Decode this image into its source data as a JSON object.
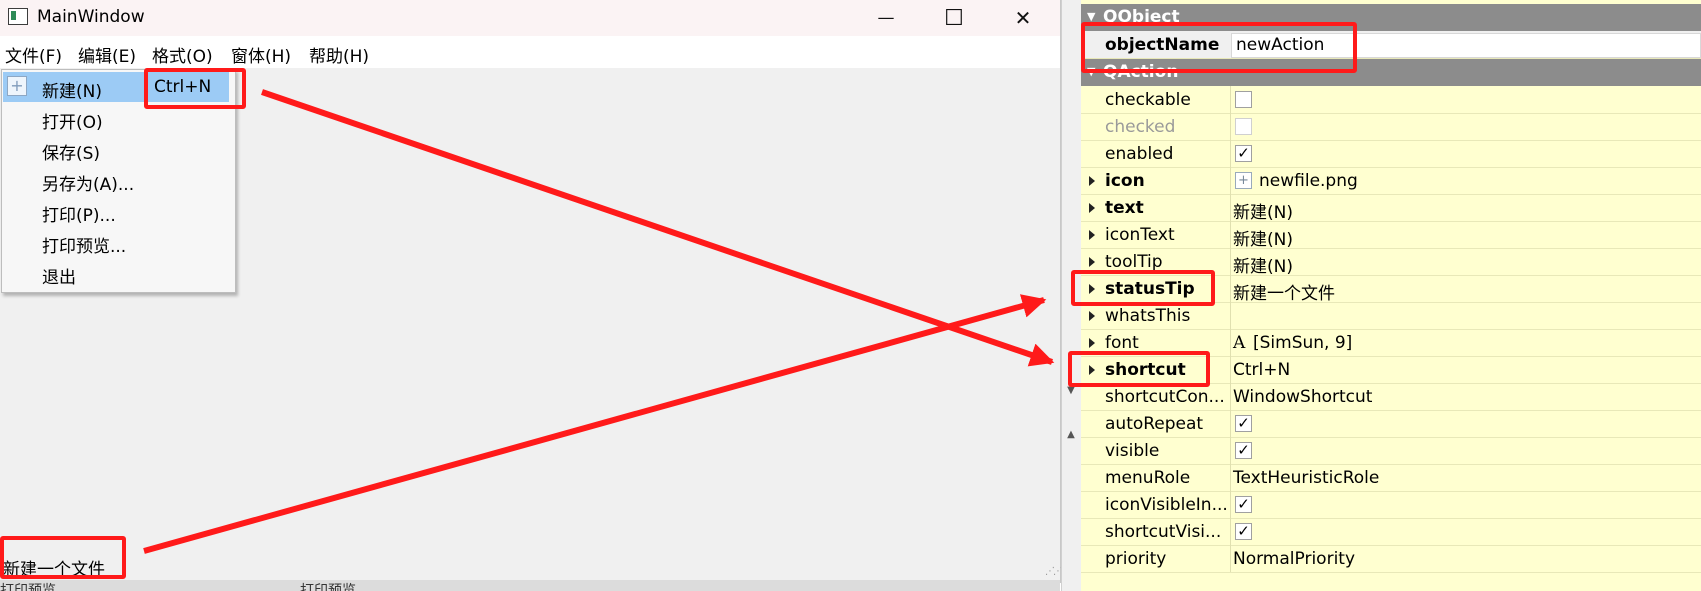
{
  "window": {
    "title": "MainWindow",
    "minimize_glyph": "—",
    "maximize_glyph": "☐",
    "close_glyph": "✕"
  },
  "menubar": [
    "文件(F)",
    "编辑(E)",
    "格式(O)",
    "窗体(H)",
    "帮助(H)"
  ],
  "file_menu": {
    "items": [
      "新建(N)",
      "打开(O)",
      "保存(S)",
      "另存为(A)...",
      "打印(P)...",
      "打印预览...",
      "退出"
    ],
    "highlighted_shortcut": "Ctrl+N",
    "new_icon_glyph": "+"
  },
  "statusbar": {
    "text": "新建一个文件",
    "strip_left": "打印预览",
    "strip_right": "打印预览"
  },
  "property_editor": {
    "groups": [
      "QObject",
      "QAction"
    ],
    "object_name": {
      "name": "objectName",
      "value": "newAction"
    },
    "rows": [
      {
        "name": "checkable",
        "value": ""
      },
      {
        "name": "checked",
        "value": ""
      },
      {
        "name": "enabled",
        "value": "✓"
      },
      {
        "name": "icon",
        "value": "newfile.png"
      },
      {
        "name": "text",
        "value": "新建(N)"
      },
      {
        "name": "iconText",
        "value": "新建(N)"
      },
      {
        "name": "toolTip",
        "value": "新建(N)"
      },
      {
        "name": "statusTip",
        "value": "新建一个文件"
      },
      {
        "name": "whatsThis",
        "value": ""
      },
      {
        "name": "font",
        "value": "[SimSun, 9]"
      },
      {
        "name": "shortcut",
        "value": "Ctrl+N"
      },
      {
        "name": "shortcutCon...",
        "value": "WindowShortcut"
      },
      {
        "name": "autoRepeat",
        "value": "✓"
      },
      {
        "name": "visible",
        "value": "✓"
      },
      {
        "name": "menuRole",
        "value": "TextHeuristicRole"
      },
      {
        "name": "iconVisibleIn...",
        "value": "✓"
      },
      {
        "name": "shortcutVisi...",
        "value": "✓"
      },
      {
        "name": "priority",
        "value": "NormalPriority"
      }
    ],
    "font_glyph": "A",
    "icon_glyph": "+"
  },
  "colors": {
    "annotation_red": "#ff1a1a",
    "menu_highlight": "#9ccbf5",
    "property_background": "#ffffd0",
    "group_header": "#8c8c8c"
  }
}
